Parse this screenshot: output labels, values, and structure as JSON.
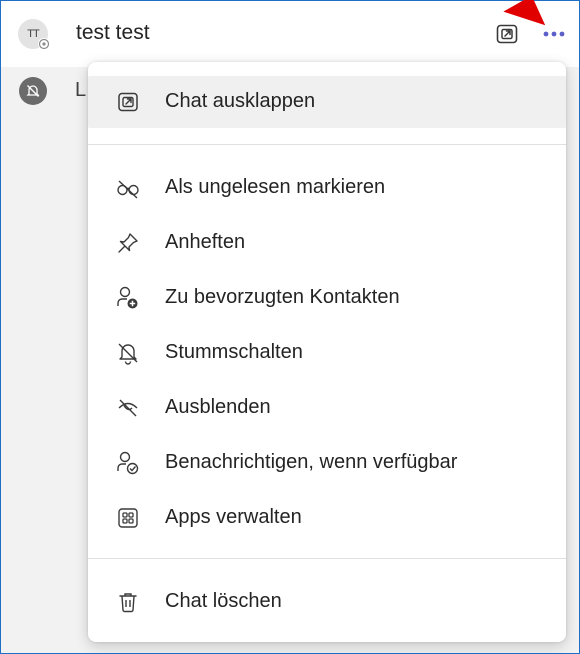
{
  "chat": {
    "avatar_initials": "TT",
    "name": "test test",
    "second_row_text": "L"
  },
  "row_actions": {
    "popout_icon": "popout-icon",
    "more_icon": "more-options-icon"
  },
  "colors": {
    "accent": "#5b5fc7",
    "frame_border": "#1f6fc5",
    "annotation_arrow": "#e00000"
  },
  "menu": {
    "items": [
      {
        "label": "Chat ausklappen",
        "icon": "popout-icon"
      },
      {
        "label": "Als ungelesen markieren",
        "icon": "unread-icon"
      },
      {
        "label": "Anheften",
        "icon": "pin-icon"
      },
      {
        "label": "Zu bevorzugten Kontakten",
        "icon": "add-contact-icon"
      },
      {
        "label": "Stummschalten",
        "icon": "mute-bell-icon"
      },
      {
        "label": "Ausblenden",
        "icon": "hide-eye-icon"
      },
      {
        "label": "Benachrichtigen, wenn verfügbar",
        "icon": "notify-available-icon"
      },
      {
        "label": "Apps verwalten",
        "icon": "apps-icon"
      },
      {
        "label": "Chat löschen",
        "icon": "trash-icon"
      }
    ]
  }
}
